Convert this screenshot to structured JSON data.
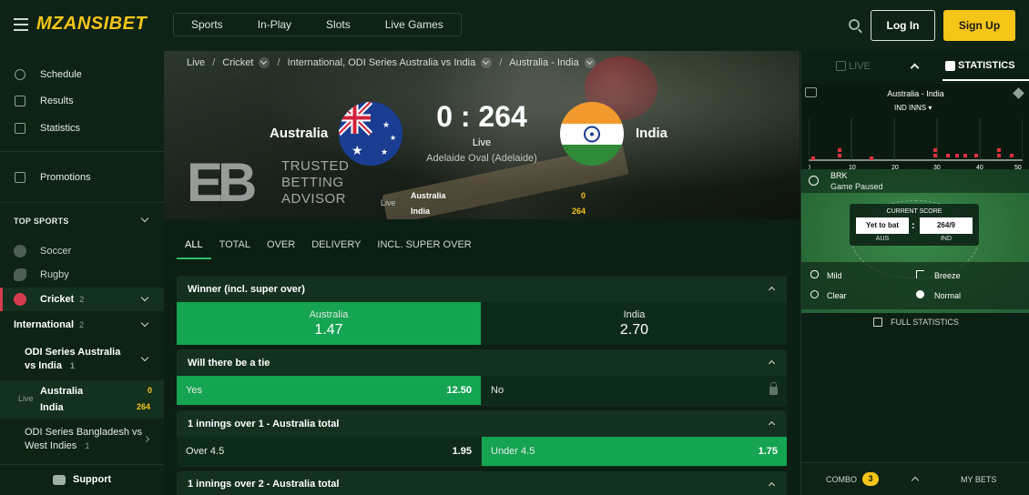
{
  "header": {
    "logo": "MZANSIBET",
    "nav": [
      "Sports",
      "In-Play",
      "Slots",
      "Live Games"
    ],
    "login": "Log In",
    "signup": "Sign Up"
  },
  "sidebar": {
    "items": [
      {
        "label": "Schedule",
        "icon": "clock-icon"
      },
      {
        "label": "Results",
        "icon": "list-icon"
      },
      {
        "label": "Statistics",
        "icon": "chart-icon"
      }
    ],
    "promotions": "Promotions",
    "top_sports": "TOP SPORTS",
    "sports": [
      {
        "label": "Soccer",
        "icon": "soccer-ball-icon"
      },
      {
        "label": "Rugby",
        "icon": "rugby-ball-icon"
      },
      {
        "label": "Cricket",
        "count": "2",
        "icon": "cricket-ball-icon"
      }
    ],
    "region": {
      "label": "International",
      "count": "2"
    },
    "series1": {
      "label": "ODI Series Australia vs India",
      "count": "1"
    },
    "event": {
      "live": "Live",
      "team1": "Australia",
      "score1": "0",
      "team2": "India",
      "score2": "264"
    },
    "series2": {
      "label": "ODI Series Bangladesh vs West Indies",
      "count": "1"
    },
    "support": "Support"
  },
  "match": {
    "breadcrumbs": [
      "Live",
      "Cricket",
      "International, ODI Series Australia vs India",
      "Australia - India"
    ],
    "home": "Australia",
    "away": "India",
    "score": "0 : 264",
    "status": "Live",
    "venue": "Adelaide Oval (Adelaide)",
    "mini": {
      "live": "Live",
      "rows": [
        {
          "team": "Australia",
          "score": "0"
        },
        {
          "team": "India",
          "score": "264"
        }
      ]
    },
    "tba": [
      "TRUSTED",
      "BETTING",
      "ADVISOR"
    ]
  },
  "tabs": [
    "ALL",
    "TOTAL",
    "OVER",
    "DELIVERY",
    "INCL. SUPER OVER"
  ],
  "markets": {
    "winner": {
      "title": "Winner (incl. super over)",
      "options": [
        {
          "name": "Australia",
          "odd": "1.47"
        },
        {
          "name": "India",
          "odd": "2.70"
        }
      ]
    },
    "tie": {
      "title": "Will there be a tie",
      "yes": "Yes",
      "yes_odd": "12.50",
      "no": "No"
    },
    "ov1": {
      "title": "1 innings over 1 - Australia total",
      "over": "Over 4.5",
      "over_odd": "1.95",
      "under": "Under 4.5",
      "under_odd": "1.75"
    },
    "ov2": {
      "title": "1 innings over 2 - Australia total"
    }
  },
  "right": {
    "live": "LIVE",
    "statistics": "STATISTICS",
    "match": "Australia - India",
    "innings": "IND INNS",
    "axis": [
      "0",
      "10",
      "20",
      "30",
      "40",
      "50"
    ],
    "brk": "BRK",
    "paused": "Game Paused",
    "current_score": "CURRENT SCORE",
    "aus_box": "Yet to bat",
    "ind_box": "264/9",
    "aus": "AUS",
    "ind": "IND",
    "weather": {
      "temp": "Mild",
      "wind": "Breeze",
      "sky": "Clear",
      "pitch": "Normal"
    },
    "full_stats": "FULL STATISTICS",
    "combo": "COMBO",
    "combo_count": "3",
    "my_bets": "MY BETS"
  }
}
